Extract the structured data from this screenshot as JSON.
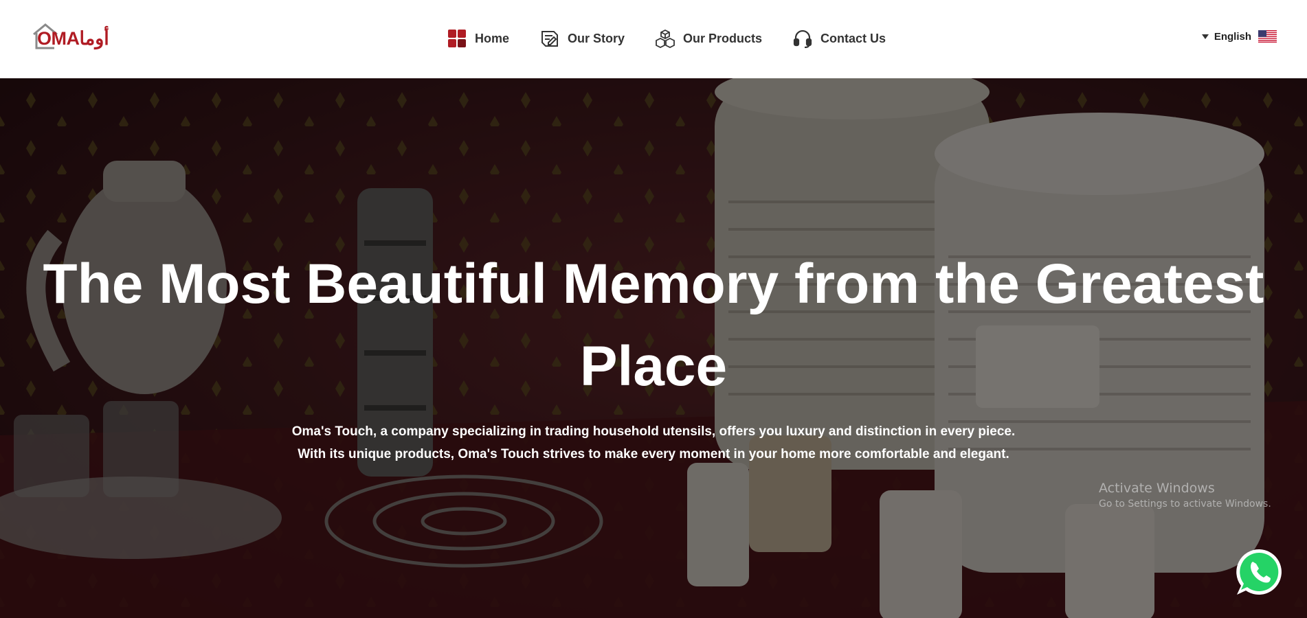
{
  "header": {
    "logo": {
      "text_latin": "OMA",
      "text_arabic": "أوما",
      "icon": "house-outline-icon"
    },
    "nav": [
      {
        "label": "Home",
        "icon": "grid-squares-icon"
      },
      {
        "label": "Our Story",
        "icon": "book-history-icon"
      },
      {
        "label": "Our Products",
        "icon": "boxes-icon"
      },
      {
        "label": "Contact Us",
        "icon": "headset-icon"
      }
    ],
    "language": {
      "label": "English",
      "icon": "us-flag-icon"
    }
  },
  "hero": {
    "title": "The Most Beautiful Memory from the Greatest Place",
    "subtitle_line1": "Oma's Touch, a company specializing in trading household utensils, offers you luxury and distinction in every piece.",
    "subtitle_line2": "With its unique products, Oma's Touch strives to make every moment in your home more comfortable and elegant."
  },
  "overlay": {
    "activate_title": "Activate Windows",
    "activate_sub": "Go to Settings to activate Windows."
  },
  "colors": {
    "brand": "#b01c24",
    "nav_text": "#333333",
    "whatsapp": "#25d366"
  }
}
